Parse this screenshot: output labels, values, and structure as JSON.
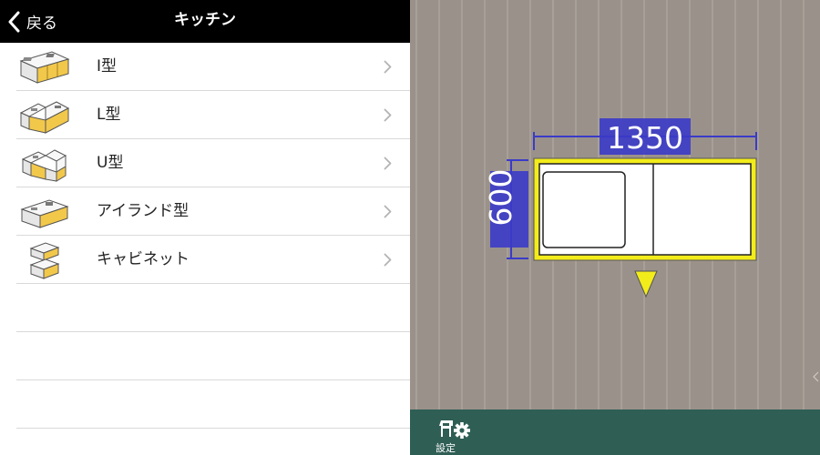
{
  "nav": {
    "back_label": "戻る",
    "title": "キッチン"
  },
  "menu": {
    "items": [
      {
        "label": "I型",
        "icon": "kitchen-i-type-icon"
      },
      {
        "label": "L型",
        "icon": "kitchen-l-type-icon"
      },
      {
        "label": "U型",
        "icon": "kitchen-u-type-icon"
      },
      {
        "label": "アイランド型",
        "icon": "kitchen-island-type-icon"
      },
      {
        "label": "キャビネット",
        "icon": "cabinet-icon"
      }
    ]
  },
  "canvas": {
    "width_dimension": "1350",
    "depth_dimension": "600",
    "colors": {
      "floor": "#9a928a",
      "floor_lines": "#b4ada5",
      "selection": "#f2ec1a",
      "dimension": "#3b3bc8"
    }
  },
  "toolbar": {
    "settings_label": "設定",
    "settings_icon": "chair-gear-icon",
    "background": "#2f5e55"
  }
}
